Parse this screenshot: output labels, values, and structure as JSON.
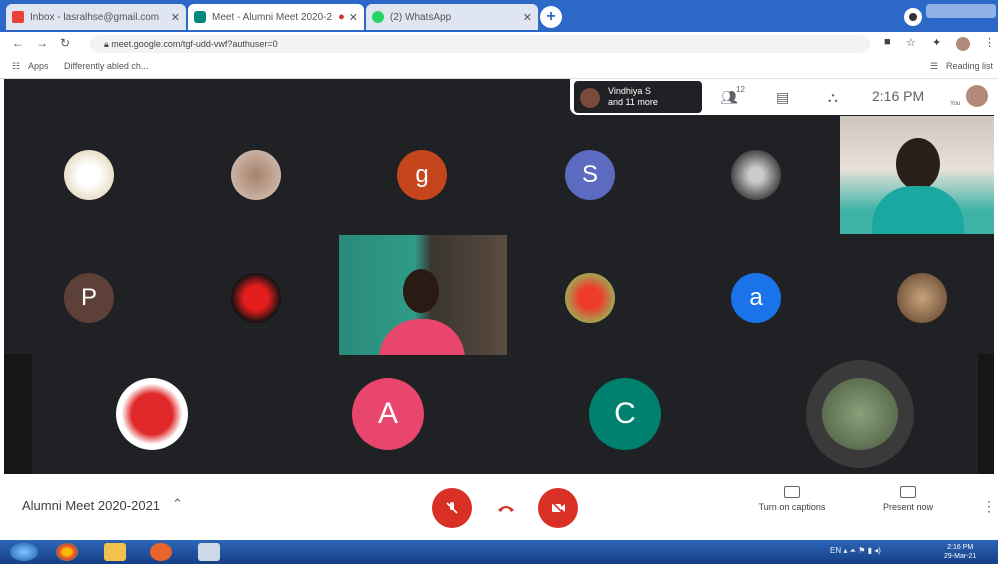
{
  "browser": {
    "tabs": [
      {
        "label": "Inbox - lasralhse@gmail.com",
        "active": false
      },
      {
        "label": "Meet - Alumni Meet 2020-2",
        "active": true
      },
      {
        "label": "(2) WhatsApp",
        "active": false
      }
    ],
    "new_tab": "+",
    "url": "meet.google.com/tgf-udd-vwf?authuser=0",
    "bookmarks": {
      "apps": "Apps",
      "item1": "Differently abled ch...",
      "reading_list": "Reading list"
    }
  },
  "meet": {
    "participants_chip": {
      "line1": "Vindhiya S",
      "line2": "and 11 more",
      "count": "12"
    },
    "time": "2:16 PM",
    "self_label": "You",
    "tiles": [
      {
        "letter": "g",
        "color": "#c5461c"
      },
      {
        "letter": "S",
        "color": "#5c6bc0"
      },
      {
        "letter": "P",
        "color": "#5d4037"
      },
      {
        "letter": "a",
        "color": "#1a73e8"
      },
      {
        "letter": "A",
        "color": "#e8466c"
      },
      {
        "letter": "C",
        "color": "#00806e"
      }
    ],
    "meeting_title": "Alumni Meet 2020-2021",
    "controls": {
      "captions": "Turn on captions",
      "present": "Present now"
    }
  },
  "taskbar": {
    "time": "2:16 PM",
    "date": "29-Mar-21",
    "lang": "EN"
  },
  "colors": {
    "meet_bg": "#202124",
    "end_red": "#d93025",
    "tab_blue": "#2b68c8"
  }
}
